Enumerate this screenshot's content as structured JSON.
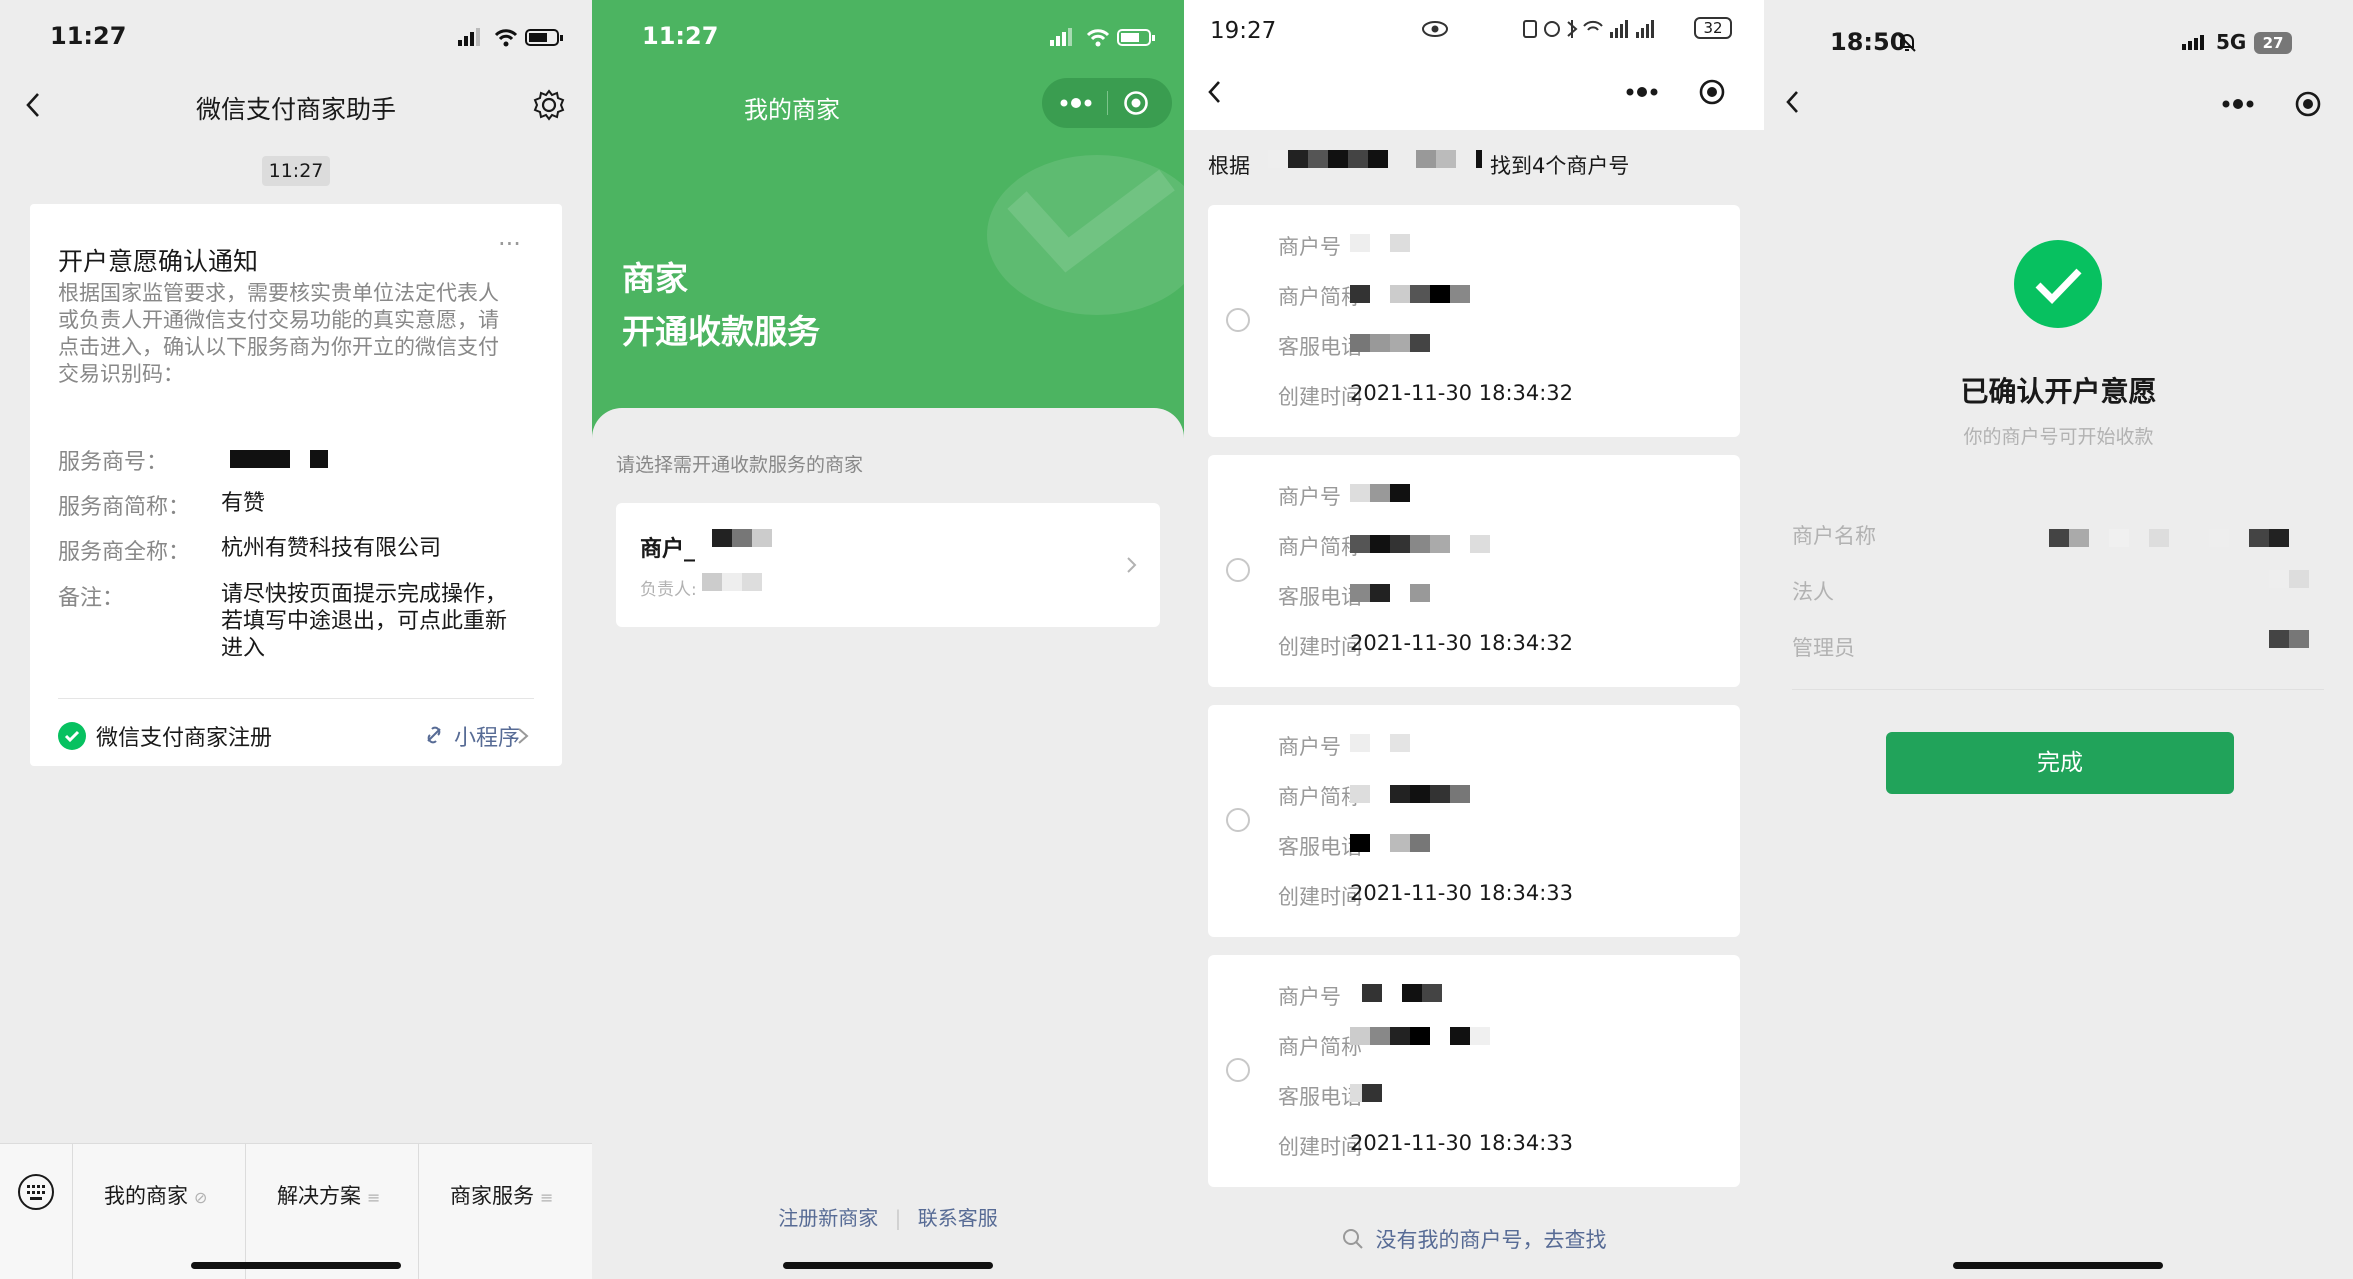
{
  "screen1": {
    "time": "11:27",
    "title": "微信支付商家助手",
    "timestamp": "11:27",
    "card": {
      "title": "开户意愿确认通知",
      "more": "···",
      "body_lines": [
        "根据国家监管要求，需要核实贵单位法定代表人",
        "或负责人开通微信支付交易功能的真实意愿，请",
        "点击进入，确认以下服务商为你开立的微信支付",
        "交易识别码："
      ],
      "provider_id_label": "服务商号：",
      "provider_short_label": "服务商简称：",
      "provider_short_value": "有赞",
      "provider_full_label": "服务商全称：",
      "provider_full_value": "杭州有赞科技有限公司",
      "remark_label": "备注：",
      "remark_lines": [
        "请尽快按页面提示完成操作，",
        "若填写中途退出，可点此重新",
        "进入"
      ],
      "footer_app": "微信支付商家注册",
      "footer_tag": "小程序"
    },
    "tabs": [
      "我的商家",
      "解决方案",
      "商家服务"
    ],
    "tab_marks": [
      "⊘",
      "≡",
      "≡"
    ]
  },
  "screen2": {
    "time": "11:27",
    "title": "我的商家",
    "hero_line1": "商家",
    "hero_line2": "开通收款服务",
    "prompt": "请选择需开通收款服务的商家",
    "merchant_name": "商户_",
    "merchant_owner": "负责人:",
    "link_register": "注册新商家",
    "link_divider": "|",
    "link_support": "联系客服"
  },
  "screen3": {
    "time": "19:27",
    "battery": "32",
    "header_prefix": "根据",
    "header_suffix": "找到4个商户号",
    "labels": {
      "id": "商户号",
      "short": "商户简称",
      "phone": "客服电话",
      "created": "创建时间"
    },
    "records": [
      {
        "created": "2021-11-30 18:34:32"
      },
      {
        "created": "2021-11-30 18:34:32"
      },
      {
        "created": "2021-11-30 18:34:33"
      },
      {
        "created": "2021-11-30 18:34:33"
      }
    ],
    "search_text": "没有我的商户号，去查找"
  },
  "screen4": {
    "time": "18:50",
    "network": "5G",
    "battery": "27",
    "title": "已确认开户意愿",
    "subtitle": "你的商户号可开始收款",
    "field_name": "商户名称",
    "field_legal": "法人",
    "field_admin": "管理员",
    "done_label": "完成"
  },
  "colors": {
    "wechat_green": "#07c160",
    "hero_green": "#4cb461",
    "button_green": "#21a35a",
    "link_blue": "#576b95",
    "background": "#ededed"
  }
}
